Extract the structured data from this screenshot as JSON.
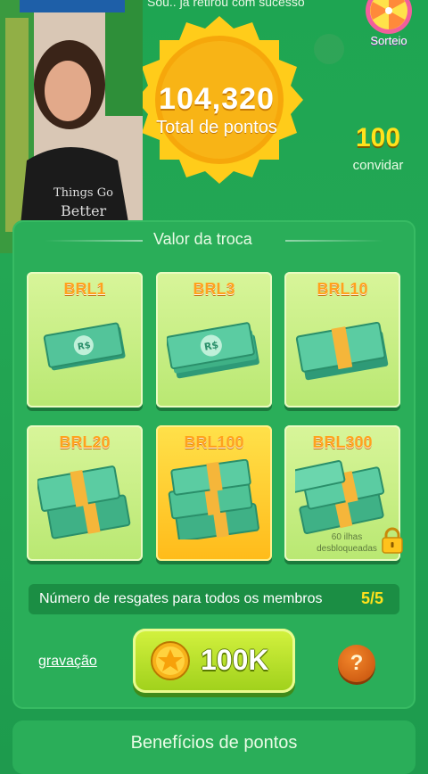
{
  "ticker": "Sou.. já retirou com sucesso",
  "points": {
    "value": "104,320",
    "label": "Total de pontos"
  },
  "invite": {
    "value": "100",
    "label": "convidar"
  },
  "wheel": {
    "label": "Sorteio"
  },
  "exchange": {
    "title": "Valor da troca",
    "cards": [
      {
        "amount": "BRL1"
      },
      {
        "amount": "BRL3"
      },
      {
        "amount": "BRL10"
      },
      {
        "amount": "BRL20"
      },
      {
        "amount": "BRL100",
        "selected": true
      },
      {
        "amount": "BRL300",
        "locked_text": "60 ilhas desbloqueadas"
      }
    ]
  },
  "redeem": {
    "label": "Número de resgates para todos os membros",
    "count": "5/5"
  },
  "history_link": "gravação",
  "claim_button": {
    "label": "100K"
  },
  "help_button": {
    "label": "?"
  },
  "benefits": {
    "title": "Benefícios de pontos"
  },
  "colors": {
    "accent": "#ffa21c",
    "panel": "#2aae59",
    "selected": "#ffbb1a"
  }
}
